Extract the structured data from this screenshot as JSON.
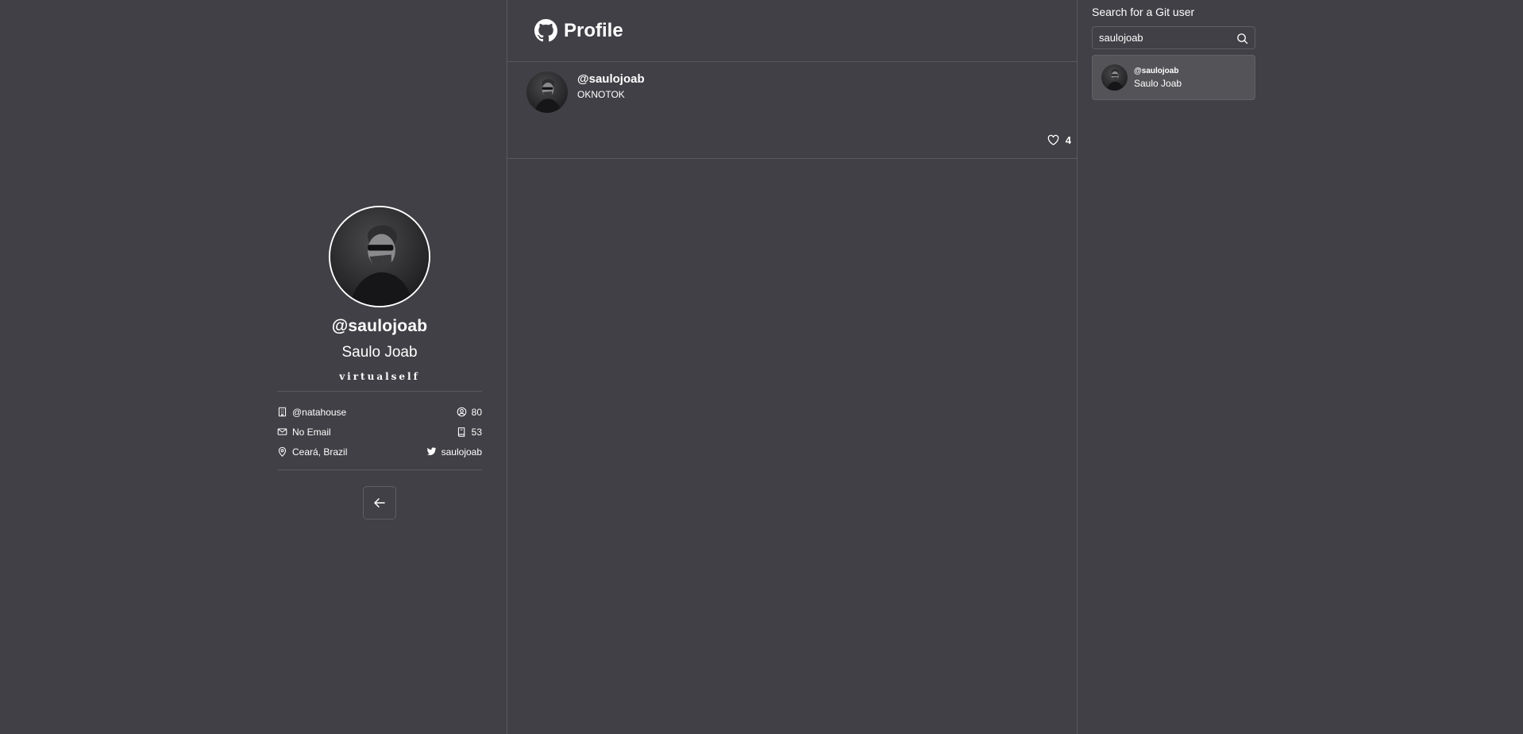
{
  "header": {
    "title": "Profile",
    "logo_icon": "github-icon"
  },
  "profile": {
    "username": "@saulojoab",
    "name": "Saulo Joab",
    "bio": "virtualself",
    "company": "@natahouse",
    "email": "No Email",
    "location": "Ceará, Brazil",
    "followers": "80",
    "repos": "53",
    "twitter": "saulojoab",
    "icons": {
      "company": "building-icon",
      "email": "mail-icon",
      "location": "map-pin-icon",
      "followers": "user-circle-icon",
      "repos": "book-icon",
      "twitter": "twitter-icon"
    },
    "back_icon": "arrow-left-icon"
  },
  "post": {
    "username": "@saulojoab",
    "text": "OKNOTOK",
    "likes": "4",
    "like_icon": "heart-icon"
  },
  "search": {
    "label": "Search for a Git user",
    "value": "saulojoab",
    "icon": "search-icon",
    "results": [
      {
        "username": "@saulojoab",
        "name": "Saulo Joab"
      }
    ]
  },
  "colors": {
    "background": "#414046",
    "border": "#59585e",
    "result_card": "#545357",
    "text": "#ffffff"
  }
}
